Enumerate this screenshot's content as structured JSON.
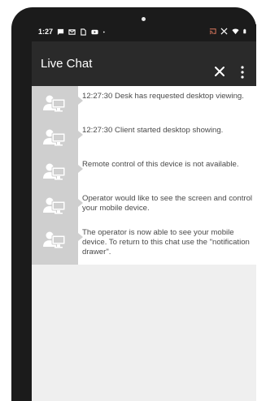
{
  "status_bar": {
    "time": "1:27",
    "left_icons": [
      "message-icon",
      "gmail-icon",
      "sim-card-icon",
      "youtube-icon",
      "dot-icon"
    ],
    "right_icons": [
      "cast-icon",
      "no-sim-icon",
      "wifi-icon",
      "battery-icon"
    ]
  },
  "app_bar": {
    "title": "Live Chat",
    "close_icon": "close-icon",
    "menu_icon": "more-vert-icon"
  },
  "messages": [
    {
      "avatar": "operator-computer-icon",
      "text": "12:27:30 Desk has requested desktop viewing."
    },
    {
      "avatar": "operator-computer-icon",
      "text": "12:27:30 Client started desktop showing."
    },
    {
      "avatar": "operator-computer-icon",
      "text": "Remote control of this device is not available."
    },
    {
      "avatar": "operator-computer-icon",
      "text": "Operator would like to see the screen and control your mobile device."
    },
    {
      "avatar": "operator-computer-icon",
      "text": "The operator is now able to see your mobile device. To return to this chat use the \"notification drawer\"."
    }
  ],
  "colors": {
    "phone_frame": "#1b1b1b",
    "app_bar": "#2a2a2a",
    "avatar_bg": "#cfcfcf",
    "chat_bg": "#efefef",
    "message_text": "#4a4a4a"
  }
}
